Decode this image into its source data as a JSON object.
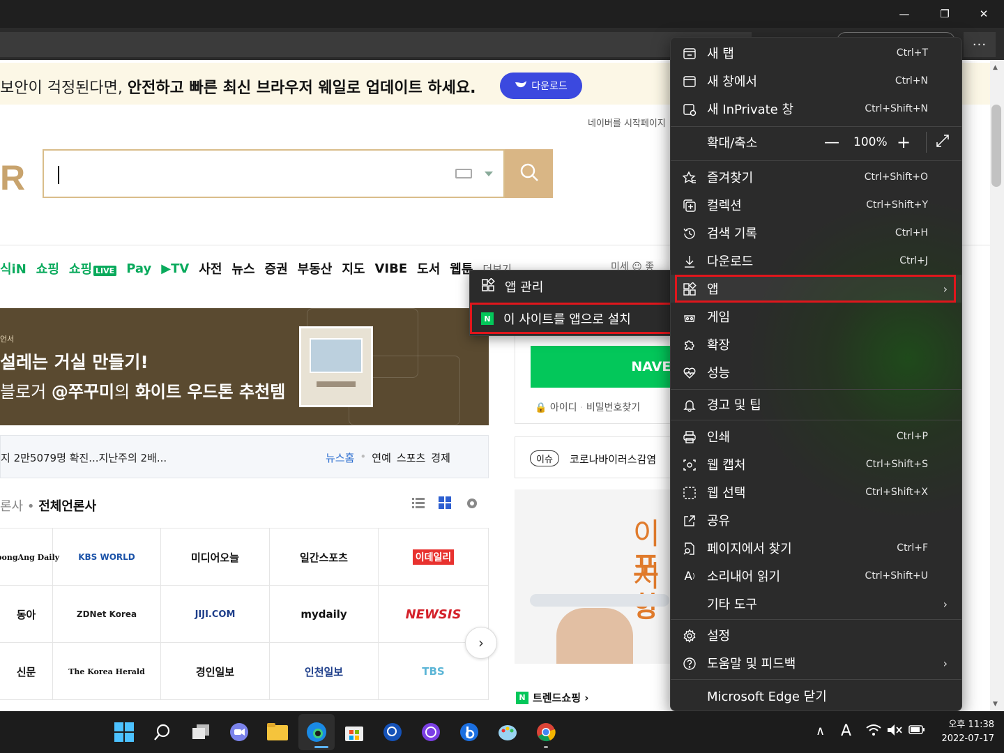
{
  "window": {
    "minimize": "—",
    "maximize": "❐",
    "close": "✕",
    "more_menu": "···"
  },
  "banner": {
    "text_prefix": "보안이 걱정된다면, ",
    "text_bold": "안전하고 빠른 최신 브라우저 웨일로 업데이트 하세요.",
    "download_label": "다운로드"
  },
  "page": {
    "startpage_text": "네이버를 시작페이지",
    "logo_fragment": "R",
    "nav": {
      "items": [
        "식iN",
        "쇼핑",
        "쇼핑",
        "Pay",
        "▶TV",
        "사전",
        "뉴스",
        "증권",
        "부동산",
        "지도",
        "VIBE",
        "도서",
        "웹툰"
      ],
      "live": "LIVE",
      "more": "더보기 ⌄"
    },
    "weather": "미세 ☺ 좋",
    "ad": {
      "small": "언서",
      "title": "설레는 거실 만들기!",
      "sub_prefix": "블로거 ",
      "sub_bold1": "@쭈꾸미",
      "sub_mid": "의 ",
      "sub_bold2": "화이트 우드톤 추천템"
    },
    "news": {
      "headline": "지 2만5079명 확진...지난주의 2배...",
      "links": [
        "뉴스홈",
        "연예",
        "스포츠",
        "경제"
      ]
    },
    "press": {
      "prefix": "론사",
      "label": "전체언론사",
      "rows": [
        [
          "JoongAng Daily",
          "KBS WORLD",
          "미디어오늘",
          "일간스포츠",
          "이데일리"
        ],
        [
          "동아",
          "ZDNet Korea",
          "JIJI.COM",
          "mydaily",
          "NEWSIS"
        ],
        [
          "신문",
          "The Korea Herald",
          "경인일보",
          "인천일보",
          "TBS"
        ]
      ],
      "next": "›"
    },
    "login": {
      "button": "NAVER",
      "id_link": "아이디",
      "pw_link": "비밀번호찾기"
    },
    "issue": {
      "tag": "이슈",
      "text": "코로나바이러스감염"
    },
    "ad2": {
      "line1": "이지",
      "line2": "포항"
    },
    "trend": "트렌드쇼핑 ›"
  },
  "submenu": {
    "items": [
      {
        "icon": "apps-icon",
        "label": "앱 관리"
      },
      {
        "icon": "naver-app-icon",
        "label": "이 사이트를 앱으로 설치",
        "badge": "N"
      }
    ]
  },
  "menu": {
    "items": [
      {
        "label": "새 탭",
        "shortcut": "Ctrl+T",
        "icon": "new-tab-icon"
      },
      {
        "label": "새 창에서",
        "shortcut": "Ctrl+N",
        "icon": "new-window-icon"
      },
      {
        "label": "새 InPrivate 창",
        "shortcut": "Ctrl+Shift+N",
        "icon": "inprivate-icon"
      },
      {
        "label": "확대/축소",
        "zoom": "100%",
        "minus": "—",
        "plus": "+",
        "expand": "⤢"
      },
      {
        "label": "즐겨찾기",
        "shortcut": "Ctrl+Shift+O",
        "icon": "favorites-icon"
      },
      {
        "label": "컬렉션",
        "shortcut": "Ctrl+Shift+Y",
        "icon": "collections-icon"
      },
      {
        "label": "검색 기록",
        "shortcut": "Ctrl+H",
        "icon": "history-icon"
      },
      {
        "label": "다운로드",
        "shortcut": "Ctrl+J",
        "icon": "download-icon"
      },
      {
        "label": "앱",
        "icon": "apps-icon",
        "chevron": "›"
      },
      {
        "label": "게임",
        "icon": "games-icon"
      },
      {
        "label": "확장",
        "icon": "extensions-icon"
      },
      {
        "label": "성능",
        "icon": "performance-icon"
      },
      {
        "label": "경고 및 팁",
        "icon": "bell-icon"
      },
      {
        "label": "인쇄",
        "shortcut": "Ctrl+P",
        "icon": "print-icon"
      },
      {
        "label": "웹 캡처",
        "shortcut": "Ctrl+Shift+S",
        "icon": "web-capture-icon"
      },
      {
        "label": "웹 선택",
        "shortcut": "Ctrl+Shift+X",
        "icon": "web-select-icon"
      },
      {
        "label": "공유",
        "icon": "share-icon"
      },
      {
        "label": "페이지에서 찾기",
        "shortcut": "Ctrl+F",
        "icon": "find-icon"
      },
      {
        "label": "소리내어 읽기",
        "shortcut": "Ctrl+Shift+U",
        "icon": "read-aloud-icon"
      },
      {
        "label": "기타 도구",
        "chevron": "›"
      },
      {
        "label": "설정",
        "icon": "settings-icon"
      },
      {
        "label": "도움말 및 피드백",
        "icon": "help-icon",
        "chevron": "›"
      },
      {
        "label": "Microsoft Edge 닫기"
      }
    ]
  },
  "taskbar": {
    "clock_time": "오후 11:38",
    "clock_date": "2022-07-17",
    "ime": "A",
    "tray_chevron": "∧"
  },
  "colors": {
    "menu_bg": "#2b2b2b",
    "highlight": "#e0161c",
    "naver_green": "#03c75a",
    "whale_blue": "#3b49df",
    "banner_bg": "#fcf7e6"
  }
}
